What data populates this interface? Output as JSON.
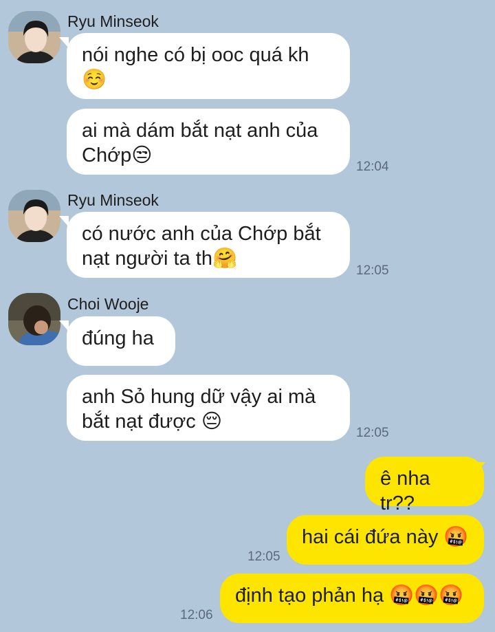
{
  "colors": {
    "background": "#b2c7da",
    "incoming_bubble": "#ffffff",
    "outgoing_bubble": "#fee500",
    "time_text": "#5a6a7a"
  },
  "messages": [
    {
      "sender": "Ryu Minseok",
      "avatar": "profile-photo-ryu-minseok",
      "text": "nói nghe có bị ooc quá kh\n☺️"
    },
    {
      "text": "ai mà dám bắt nạt anh của\nChớp😒",
      "time": "12:04"
    },
    {
      "sender": "Ryu Minseok",
      "avatar": "profile-photo-ryu-minseok",
      "text": "có nước anh của Chớp bắt\nnạt người ta th🤗",
      "time": "12:05"
    },
    {
      "sender": "Choi Wooje",
      "avatar": "profile-photo-choi-wooje",
      "text": "đúng ha"
    },
    {
      "text": "anh Sỏ hung dữ vậy ai mà\nbắt nạt được 😔",
      "time": "12:05"
    },
    {
      "outgoing": true,
      "text": "ê nha tr??"
    },
    {
      "outgoing": true,
      "text": "hai cái đứa này 🤬",
      "time": "12:05"
    },
    {
      "outgoing": true,
      "text": "định tạo phản hạ 🤬🤬🤬",
      "time": "12:06"
    }
  ]
}
